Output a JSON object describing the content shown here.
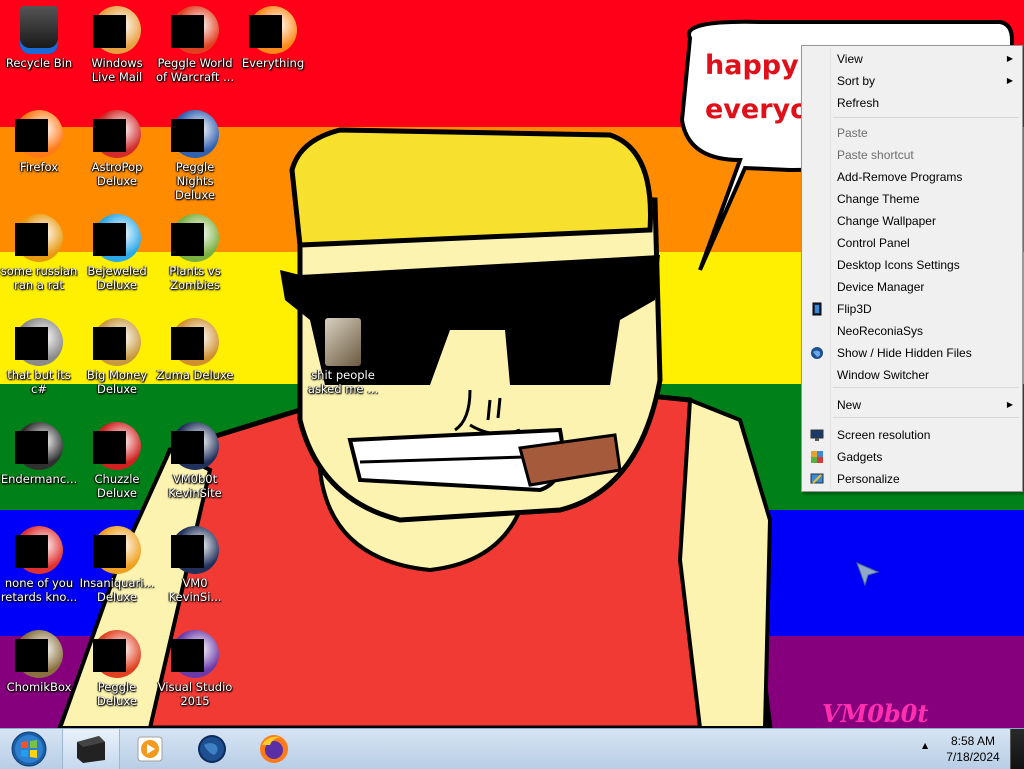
{
  "wallpaper": {
    "speech_text_line1": "happy p",
    "speech_text_line2": "everyon",
    "signature": "VM0b0t",
    "stripe_colors": [
      "#ff0018",
      "#ff8c00",
      "#ffef00",
      "#008018",
      "#0000f9",
      "#86007d"
    ]
  },
  "desktop_icons": [
    {
      "label": "Recycle Bin",
      "icon": "recycle-bin-icon",
      "masked": false
    },
    {
      "label": "Windows Live Mail",
      "icon": "mail-icon",
      "masked": true
    },
    {
      "label": "Peggle World of Warcraft ...",
      "icon": "peggle-icon",
      "masked": true
    },
    {
      "label": "Everything",
      "icon": "search-app-icon",
      "masked": true
    },
    {
      "label": "Firefox",
      "icon": "firefox-icon",
      "masked": true
    },
    {
      "label": "AstroPop Deluxe",
      "icon": "astropop-icon",
      "masked": true
    },
    {
      "label": "Peggle Nights Deluxe",
      "icon": "peggle-nights-icon",
      "masked": true
    },
    {
      "label": "VM0b0t KevinSite",
      "icon": "vm-icon",
      "masked": true
    },
    {
      "label": "some russian ran a rat",
      "icon": "ie-icon",
      "masked": true
    },
    {
      "label": "Bejeweled Deluxe",
      "icon": "bejeweled-icon",
      "masked": true
    },
    {
      "label": "Plants vs Zombies",
      "icon": "pvz-icon",
      "masked": true
    },
    {
      "label": "VM0 KevinSi...",
      "icon": "vm-icon",
      "masked": true
    },
    {
      "label": "that but its c#",
      "icon": "stack-icon",
      "masked": true
    },
    {
      "label": "Big Money Deluxe",
      "icon": "big-money-icon",
      "masked": true
    },
    {
      "label": "Zuma Deluxe",
      "icon": "zuma-icon",
      "masked": true
    },
    {
      "label": "Visual Studio 2015",
      "icon": "visual-studio-icon",
      "masked": true
    },
    {
      "label": "Endermanc...",
      "icon": "console-icon",
      "masked": true
    },
    {
      "label": "Chuzzle Deluxe",
      "icon": "chuzzle-icon",
      "masked": true
    },
    {
      "label": "none of you retards kno...",
      "icon": "app-icon",
      "masked": true
    },
    {
      "label": "Insaniquari... Deluxe",
      "icon": "insaniquarium-icon",
      "masked": true
    },
    {
      "label": "ChomikBox",
      "icon": "chomikbox-icon",
      "masked": true
    },
    {
      "label": "Peggle Deluxe",
      "icon": "peggle-icon",
      "masked": true
    },
    {
      "label": "shit people asked me ...",
      "icon": "folder-icon",
      "masked": false
    }
  ],
  "context_menu": {
    "items": [
      {
        "label": "View",
        "submenu": true
      },
      {
        "label": "Sort by",
        "submenu": true
      },
      {
        "label": "Refresh"
      },
      {
        "label": "Paste",
        "disabled": true
      },
      {
        "label": "Paste shortcut",
        "disabled": true
      },
      {
        "label": "Add-Remove Programs"
      },
      {
        "label": "Change Theme"
      },
      {
        "label": "Change Wallpaper"
      },
      {
        "label": "Control Panel"
      },
      {
        "label": "Desktop Icons Settings"
      },
      {
        "label": "Device Manager"
      },
      {
        "label": "Flip3D",
        "icon": "flip3d-icon"
      },
      {
        "label": "NeoReconiaSys"
      },
      {
        "label": "Show / Hide Hidden Files",
        "icon": "globe-icon"
      },
      {
        "label": "Window Switcher"
      },
      {
        "label": "New",
        "submenu": true
      },
      {
        "label": "Screen resolution",
        "icon": "monitor-icon"
      },
      {
        "label": "Gadgets",
        "icon": "gadgets-icon"
      },
      {
        "label": "Personalize",
        "icon": "personalize-icon"
      }
    ]
  },
  "taskbar": {
    "start_icon": "windows-start-icon",
    "pinned": [
      "terminal-icon",
      "media-player-icon",
      "globe-icon",
      "firefox-icon"
    ],
    "time": "8:58 AM",
    "date": "7/18/2024"
  }
}
